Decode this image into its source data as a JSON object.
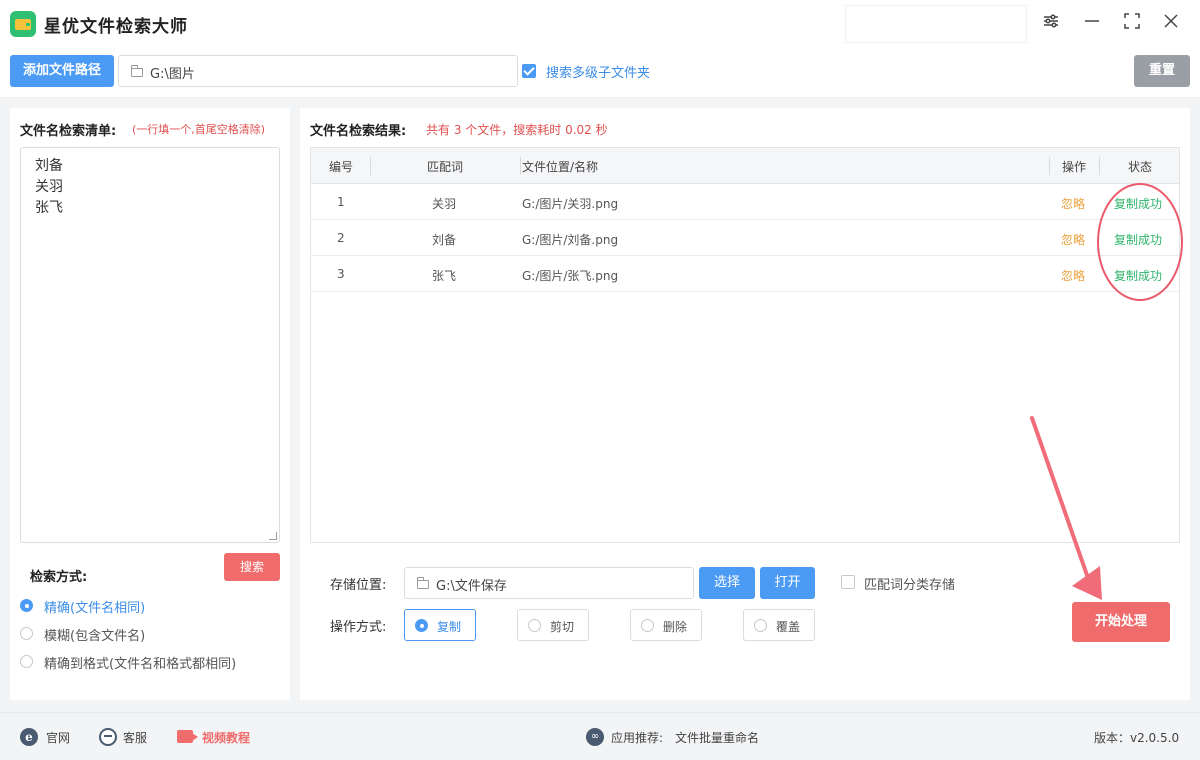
{
  "app": {
    "title": "星优文件检索大师"
  },
  "toolbar": {
    "add_path_label": "添加文件路径",
    "path_value": "G:\\图片",
    "subfolder_label": "搜索多级子文件夹",
    "subfolder_checked": true,
    "reset_label": "重置"
  },
  "left": {
    "title": "文件名检索清单:",
    "hint": "(一行填一个,首尾空格清除)",
    "names": [
      "刘备",
      "关羽",
      "张飞"
    ],
    "mode_label": "检索方式:",
    "search_label": "搜索",
    "modes": [
      {
        "label": "精确(文件名相同)",
        "selected": true
      },
      {
        "label": "模糊(包含文件名)",
        "selected": false
      },
      {
        "label": "精确到格式(文件名和格式都相同)",
        "selected": false
      }
    ]
  },
  "results": {
    "title": "文件名检索结果:",
    "summary": "共有 3 个文件，搜索耗时 0.02 秒",
    "columns": [
      "编号",
      "匹配词",
      "文件位置/名称",
      "操作",
      "状态"
    ],
    "rows": [
      {
        "no": "1",
        "word": "关羽",
        "path": "G:/图片/关羽.png",
        "op": "忽略",
        "status": "复制成功"
      },
      {
        "no": "2",
        "word": "刘备",
        "path": "G:/图片/刘备.png",
        "op": "忽略",
        "status": "复制成功"
      },
      {
        "no": "3",
        "word": "张飞",
        "path": "G:/图片/张飞.png",
        "op": "忽略",
        "status": "复制成功"
      }
    ]
  },
  "storage": {
    "label": "存储位置:",
    "path": "G:\\文件保存",
    "choose_label": "选择",
    "open_label": "打开",
    "classify_label": "匹配词分类存储",
    "classify_checked": false
  },
  "operation": {
    "label": "操作方式:",
    "options": [
      {
        "label": "复制",
        "selected": true
      },
      {
        "label": "剪切",
        "selected": false
      },
      {
        "label": "删除",
        "selected": false
      },
      {
        "label": "覆盖",
        "selected": false
      }
    ],
    "start_label": "开始处理"
  },
  "footer": {
    "website": "官网",
    "support": "客服",
    "video": "视频教程",
    "recommend_label": "应用推荐:",
    "recommend_app": "文件批量重命名",
    "version": "版本：v2.0.5.0"
  },
  "colors": {
    "primary": "#4b9bf5",
    "danger": "#f06c6c",
    "success": "#2fb56b",
    "warning": "#eba13b"
  }
}
